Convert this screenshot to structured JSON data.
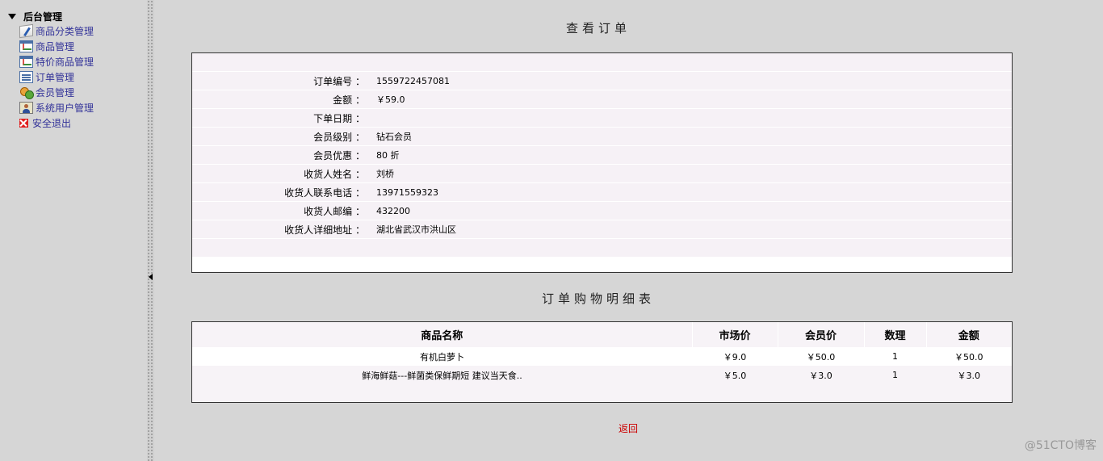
{
  "sidebar": {
    "root": "后台管理",
    "items": [
      {
        "label": "商品分类管理",
        "icon": "edit-icon"
      },
      {
        "label": "商品管理",
        "icon": "chart-icon"
      },
      {
        "label": "特价商品管理",
        "icon": "chart-icon"
      },
      {
        "label": "订单管理",
        "icon": "list-icon"
      },
      {
        "label": "会员管理",
        "icon": "group-icon"
      },
      {
        "label": "系统用户管理",
        "icon": "user-icon"
      },
      {
        "label": "安全退出",
        "icon": "exit-icon"
      }
    ]
  },
  "order": {
    "title": "查看订单",
    "fields": [
      {
        "key": "订单编号 ：",
        "value": "1559722457081"
      },
      {
        "key": "金额 ：",
        "value": "￥59.0"
      },
      {
        "key": "下单日期 ：",
        "value": ""
      },
      {
        "key": "会员级别 ：",
        "value": "钻石会员"
      },
      {
        "key": "会员优惠 ：",
        "value": "80 折"
      },
      {
        "key": "收货人姓名 ：",
        "value": "刘桥"
      },
      {
        "key": "收货人联系电话 ：",
        "value": "13971559323"
      },
      {
        "key": "收货人邮编 ：",
        "value": "432200"
      },
      {
        "key": "收货人详细地址 ：",
        "value": "湖北省武汉市洪山区"
      }
    ]
  },
  "details": {
    "title": "订单购物明细表",
    "columns": [
      "商品名称",
      "市场价",
      "会员价",
      "数理",
      "金额"
    ],
    "rows": [
      [
        "有机白萝卜",
        "￥9.0",
        "￥50.0",
        "1",
        "￥50.0"
      ],
      [
        "鲜海鲜菇---鲜菌类保鲜期短 建议当天食..",
        "￥5.0",
        "￥3.0",
        "1",
        "￥3.0"
      ]
    ]
  },
  "return_label": "返回",
  "watermark": "@51CTO博客",
  "colors": {
    "accent_link": "#333399",
    "return": "#cc0000",
    "background": "#d6d6d6"
  }
}
